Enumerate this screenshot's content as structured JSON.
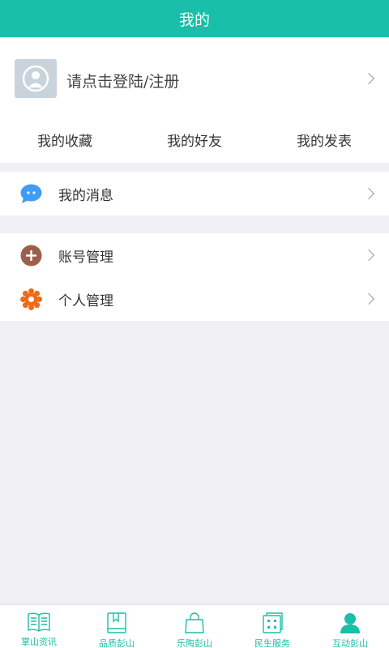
{
  "header": {
    "title": "我的"
  },
  "profile": {
    "login_prompt": "请点击登陆/注册",
    "quick_links": [
      "我的收藏",
      "我的好友",
      "我的发表"
    ]
  },
  "menu": {
    "messages": {
      "label": "我的消息",
      "icon": "chat-bubble-icon"
    },
    "account": {
      "label": "账号管理",
      "icon": "plus-circle-icon"
    },
    "personal": {
      "label": "个人管理",
      "icon": "gear-icon"
    }
  },
  "tabbar": {
    "tabs": [
      {
        "label": "掌山资讯",
        "icon": "book-open-icon"
      },
      {
        "label": "品质彭山",
        "icon": "bookmark-book-icon"
      },
      {
        "label": "乐陶彭山",
        "icon": "shopping-bag-icon"
      },
      {
        "label": "民生服务",
        "icon": "grid-card-icon"
      },
      {
        "label": "互动彭山",
        "icon": "user-icon"
      }
    ]
  },
  "colors": {
    "accent": "#19bfa8",
    "message_icon": "#3d9df5",
    "account_icon": "#9b5f4b",
    "personal_icon": "#f06a1a",
    "background": "#efeff4"
  }
}
